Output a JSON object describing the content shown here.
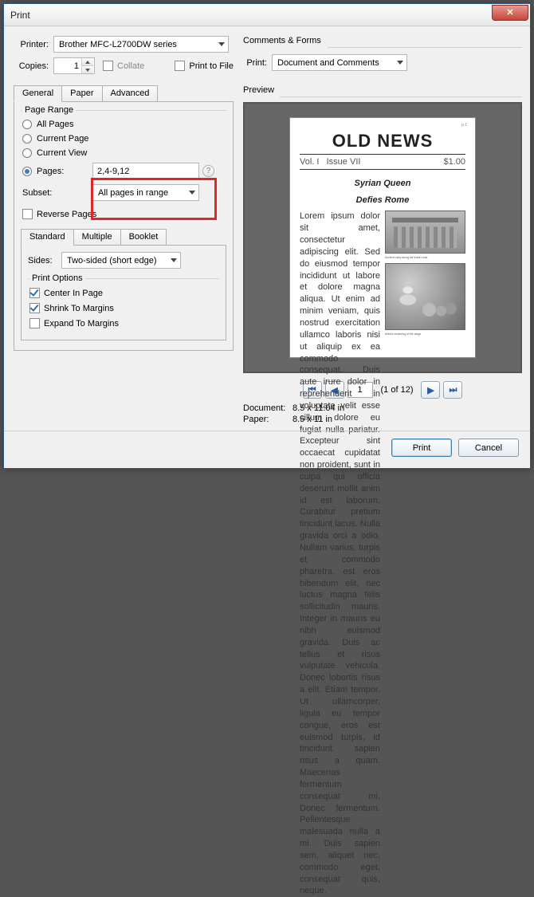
{
  "window": {
    "title": "Print"
  },
  "printer": {
    "label": "Printer:",
    "selected": "Brother MFC-L2700DW series",
    "copies_label": "Copies:",
    "copies_value": "1",
    "collate_label": "Collate",
    "collate_checked": false,
    "print_to_file_label": "Print to File",
    "print_to_file_checked": false
  },
  "tabs_main": {
    "items": [
      "General",
      "Paper",
      "Advanced"
    ],
    "active": 0
  },
  "page_range": {
    "legend": "Page Range",
    "options": {
      "all": "All Pages",
      "current_page": "Current Page",
      "current_view": "Current View",
      "pages": "Pages:"
    },
    "selected": "pages",
    "pages_value": "2,4-9,12",
    "subset_label": "Subset:",
    "subset_value": "All pages in range",
    "reverse_label": "Reverse Pages",
    "reverse_checked": false
  },
  "tabs_layout": {
    "items": [
      "Standard",
      "Multiple",
      "Booklet"
    ],
    "active": 0
  },
  "sides": {
    "label": "Sides:",
    "value": "Two-sided (short edge)"
  },
  "print_options": {
    "legend": "Print Options",
    "center_label": "Center In Page",
    "center_checked": true,
    "shrink_label": "Shrink To Margins",
    "shrink_checked": true,
    "expand_label": "Expand To Margins",
    "expand_checked": false
  },
  "comments": {
    "legend": "Comments & Forms",
    "print_label": "Print:",
    "value": "Document and Comments"
  },
  "preview": {
    "legend": "Preview",
    "doc": {
      "masthead": "OLD NEWS",
      "headline1": "Syrian Queen",
      "headline2": "Defies Rome"
    },
    "pager": {
      "current": "1",
      "of_text": "(1 of 12)"
    },
    "doc_size_label": "Document:",
    "doc_size_value": "8.5 x 11.04 in",
    "paper_size_label": "Paper:",
    "paper_size_value": "8.5 x 11 in"
  },
  "buttons": {
    "print": "Print",
    "cancel": "Cancel"
  },
  "colors": {
    "highlight": "#e02626"
  }
}
